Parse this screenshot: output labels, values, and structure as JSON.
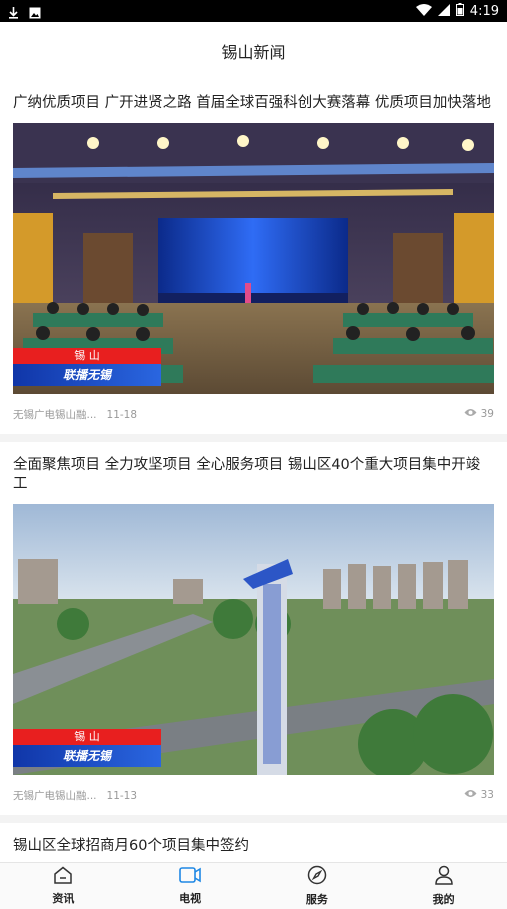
{
  "status": {
    "time": "4:19"
  },
  "header": {
    "title": "锡山新闻"
  },
  "articles": [
    {
      "headline": "广纳优质项目 广开进贤之路 首届全球百强科创大赛落幕 优质项目加快落地",
      "source": "无锡广电锡山融...",
      "date": "11-18",
      "views": "39",
      "badge_top": "锡 山",
      "badge_bottom": "联播无锡"
    },
    {
      "headline": "全面聚焦项目 全力攻坚项目 全心服务项目 锡山区40个重大项目集中开竣工",
      "source": "无锡广电锡山融...",
      "date": "11-13",
      "views": "33",
      "badge_top": "锡 山",
      "badge_bottom": "联播无锡"
    },
    {
      "headline": "锡山区全球招商月60个项目集中签约"
    }
  ],
  "tabbar": {
    "items": [
      {
        "label": "资讯",
        "icon": "home-icon"
      },
      {
        "label": "电视",
        "icon": "tv-icon"
      },
      {
        "label": "服务",
        "icon": "compass-icon"
      },
      {
        "label": "我的",
        "icon": "user-icon"
      }
    ],
    "active_index": 1,
    "active_color": "#1e88e5"
  }
}
